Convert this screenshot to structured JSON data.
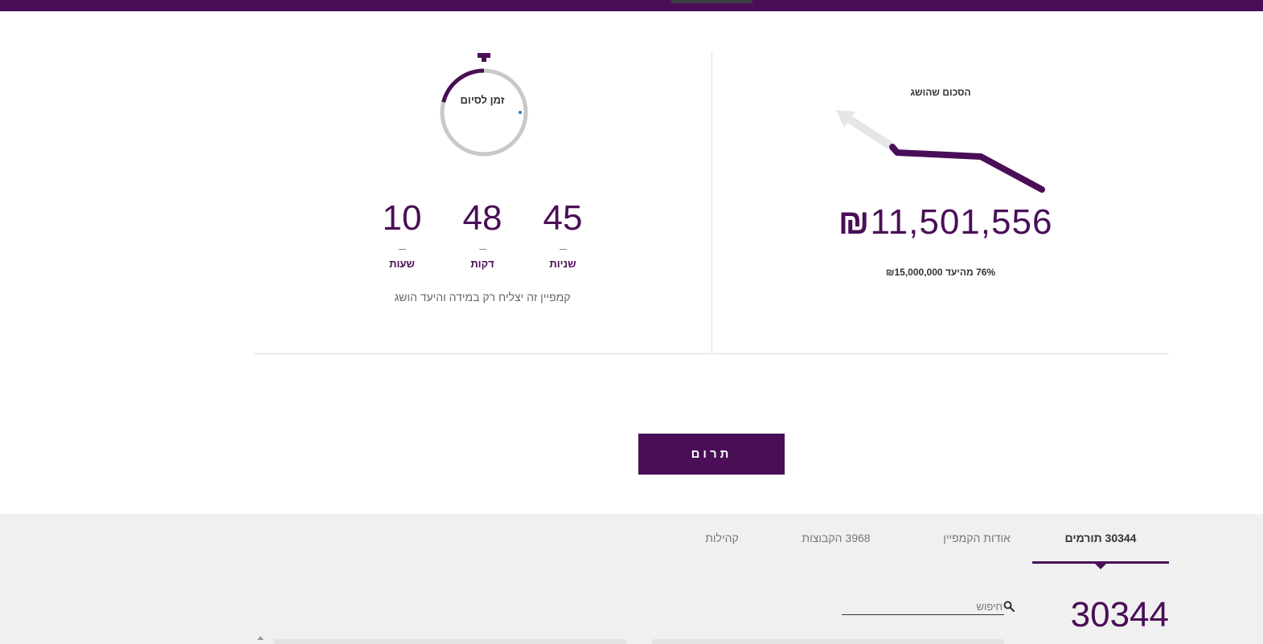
{
  "colors": {
    "brand": "#4a0e57",
    "track": "#c8c8c8",
    "arrow_track": "#e6e6e6",
    "bottom_bg": "#f0f0f0"
  },
  "fundraising": {
    "raised_label": "הסכום שהושג",
    "amount": "11,501,556",
    "currency": "₪",
    "goal_line": "76% מהיעד ₪15,000,000",
    "progress_percent": 76
  },
  "timer": {
    "label": "זמן לסיום",
    "icon": "stopwatch-icon",
    "elapsed_fraction": 0.21,
    "units": [
      {
        "value": "45",
        "label": "שניות"
      },
      {
        "value": "48",
        "label": "דקות"
      },
      {
        "value": "10",
        "label": "שעות"
      }
    ],
    "note": "קמפיין זה יצליח רק במידה והיעד הושג"
  },
  "donate_button": {
    "label": "תרום"
  },
  "tabs": [
    {
      "label": "30344 תורמים",
      "active": true
    },
    {
      "label": "אודות הקמפיין",
      "active": false
    },
    {
      "label": "3968 הקבוצות",
      "active": false
    },
    {
      "label": "קהילות",
      "active": false
    }
  ],
  "search": {
    "placeholder": "חיפוש",
    "icon": "search-icon"
  },
  "donor_count": "30344"
}
